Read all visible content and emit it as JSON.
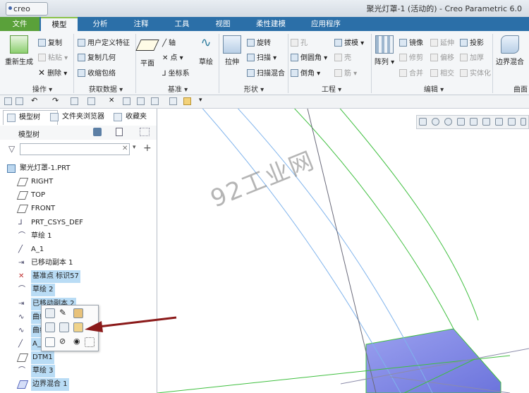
{
  "window": {
    "app_logo": "creo",
    "title": "聚光灯罩-1 (活动的) - Creo Parametric 6.0"
  },
  "tabs": [
    "文件",
    "模型",
    "分析",
    "注释",
    "工具",
    "视图",
    "柔性建模",
    "应用程序"
  ],
  "active_tab": "模型",
  "ribbon": {
    "operations": {
      "regen": "重新生成",
      "copy": "复制",
      "paste": "粘贴",
      "delete": "删除",
      "group": "操作"
    },
    "get_data": {
      "udf": "用户定义特征",
      "copy_geom": "复制几何",
      "shrinkwrap": "收缩包络",
      "group": "获取数据"
    },
    "datum": {
      "plane": "平面",
      "axis": "轴",
      "point": "点",
      "csys": "坐标系",
      "sketch": "草绘",
      "group": "基准"
    },
    "shapes": {
      "extrude": "拉伸",
      "revolve": "旋转",
      "sweep": "扫描",
      "swept_blend": "扫描混合",
      "group": "形状"
    },
    "engineering": {
      "hole": "孔",
      "round": "倒圆角",
      "chamfer": "倒角",
      "draft": "拔模",
      "shell": "壳",
      "rib": "筋",
      "group": "工程"
    },
    "editing": {
      "pattern": "阵列",
      "mirror": "镜像",
      "trim": "修剪",
      "merge": "合并",
      "extend": "延伸",
      "offset": "偏移",
      "intersect": "相交",
      "project": "投影",
      "thicken": "加厚",
      "solidify": "实体化",
      "group": "编辑"
    },
    "surfaces": {
      "boundary_blend": "边界混合",
      "group": "曲面"
    }
  },
  "panel": {
    "tabs": [
      "模型树",
      "文件夹浏览器",
      "收藏夹"
    ],
    "tree_label": "模型树",
    "search_value": "",
    "items": [
      {
        "label": "聚光灯罩-1.PRT",
        "icon": "part-icon",
        "selected": false
      },
      {
        "label": "RIGHT",
        "icon": "datum-plane-icon",
        "selected": false
      },
      {
        "label": "TOP",
        "icon": "datum-plane-icon",
        "selected": false
      },
      {
        "label": "FRONT",
        "icon": "datum-plane-icon",
        "selected": false
      },
      {
        "label": "PRT_CSYS_DEF",
        "icon": "csys-icon",
        "selected": false
      },
      {
        "label": "草绘 1",
        "icon": "sketch-icon",
        "selected": false
      },
      {
        "label": "A_1",
        "icon": "axis-icon",
        "selected": false
      },
      {
        "label": "已移动副本 1",
        "icon": "moved-copy-icon",
        "selected": false
      },
      {
        "label": "基准点 标识57",
        "icon": "datum-point-icon",
        "selected": true
      },
      {
        "label": "草绘 2",
        "icon": "sketch-icon",
        "selected": true
      },
      {
        "label": "已移动副本 2",
        "icon": "moved-copy-icon",
        "selected": true
      },
      {
        "label": "曲线",
        "icon": "curve-icon",
        "selected": true
      },
      {
        "label": "曲线",
        "icon": "curve-icon",
        "selected": true
      },
      {
        "label": "A_2",
        "icon": "axis-icon",
        "selected": true
      },
      {
        "label": "DTM1",
        "icon": "datum-plane-icon",
        "selected": true
      },
      {
        "label": "草绘 3",
        "icon": "sketch-icon",
        "selected": true
      },
      {
        "label": "边界混合 1",
        "icon": "boundary-blend-icon",
        "selected": true
      }
    ]
  },
  "watermark": "92工业网",
  "colors": {
    "tab_bar": "#2b6fa8",
    "file_tab": "#5aa13a",
    "selection": "#b9dcf5",
    "surface": "#7f86e6",
    "arrow": "#8b1a1a"
  }
}
